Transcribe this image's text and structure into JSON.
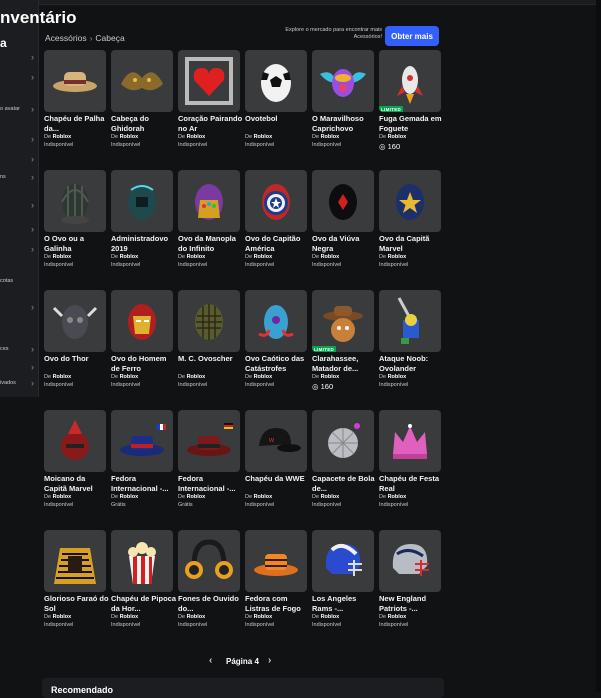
{
  "page": {
    "title": "nventário",
    "breadcrumb": [
      "Acessórios",
      "Cabeça"
    ],
    "explore_text": "Explore o mercado para encontrar mais Acessórios!",
    "get_more_label": "Obter mais",
    "page_label": "Página 4",
    "recommended_label": "Recomendado"
  },
  "sidebar": {
    "title": "a",
    "items": [
      {
        "label": "",
        "chevron": "›"
      },
      {
        "label": "",
        "chevron": "›"
      },
      {
        "label": "o avatar",
        "chevron": "›"
      },
      {
        "label": "",
        "chevron": "›"
      },
      {
        "label": "",
        "chevron": "›"
      },
      {
        "label": "ns",
        "chevron": "›"
      },
      {
        "label": "",
        "chevron": "›"
      },
      {
        "label": "",
        "chevron": "›"
      },
      {
        "label": "",
        "chevron": "›"
      },
      {
        "label": "cotas",
        "chevron": ""
      },
      {
        "label": "",
        "chevron": "›"
      },
      {
        "label": "",
        "chevron": ""
      },
      {
        "label": "ces",
        "chevron": "›"
      },
      {
        "label": "",
        "chevron": "›"
      },
      {
        "label": "ivados",
        "chevron": "›"
      }
    ]
  },
  "items": [
    {
      "name": "Chapéu de Palha da...",
      "creator_prefix": "De",
      "creator": "Roblox",
      "status": "Indisponível",
      "icon": "straw-hat-icon"
    },
    {
      "name": "Cabeça do Ghidorah",
      "creator_prefix": "De",
      "creator": "Roblox",
      "status": "Indisponível",
      "icon": "ghidorah-head-icon"
    },
    {
      "name": "Coração Pairando no Ar",
      "creator_prefix": "De",
      "creator": "Roblox",
      "status": "Indisponível",
      "icon": "floating-heart-icon"
    },
    {
      "name": "Ovotebol",
      "creator_prefix": "De",
      "creator": "Roblox",
      "status": "Indisponível",
      "icon": "soccer-egg-icon"
    },
    {
      "name": "O Maravilhoso Caprichovo",
      "creator_prefix": "De",
      "creator": "Roblox",
      "status": "Indisponível",
      "icon": "winged-egg-icon"
    },
    {
      "name": "Fuga Gemada em Foguete",
      "creator_prefix": "De",
      "creator": "Roblox",
      "status": "",
      "price": "160",
      "badge": "LIMITED",
      "icon": "rocket-egg-icon"
    },
    {
      "name": "O Ovo ou a Galinha",
      "creator_prefix": "De",
      "creator": "Roblox",
      "status": "Indisponível",
      "icon": "caged-egg-icon"
    },
    {
      "name": "Administradovo 2019",
      "creator_prefix": "De",
      "creator": "Roblox",
      "status": "Indisponível",
      "icon": "admin-egg-icon"
    },
    {
      "name": "Ovo da Manopla do Infinito",
      "creator_prefix": "De",
      "creator": "Roblox",
      "status": "Indisponível",
      "icon": "gauntlet-egg-icon"
    },
    {
      "name": "Ovo do Capitão América",
      "creator_prefix": "De",
      "creator": "Roblox",
      "status": "Indisponível",
      "icon": "captain-america-egg-icon"
    },
    {
      "name": "Ovo da Viúva Negra",
      "creator_prefix": "De",
      "creator": "Roblox",
      "status": "Indisponível",
      "icon": "black-widow-egg-icon"
    },
    {
      "name": "Ovo da Capitã Marvel",
      "creator_prefix": "De",
      "creator": "Roblox",
      "status": "Indisponível",
      "icon": "captain-marvel-egg-icon"
    },
    {
      "name": "Ovo do Thor",
      "creator_prefix": "De",
      "creator": "Roblox",
      "status": "Indisponível",
      "icon": "thor-egg-icon"
    },
    {
      "name": "Ovo do Homem de Ferro",
      "creator_prefix": "De",
      "creator": "Roblox",
      "status": "Indisponível",
      "icon": "iron-man-egg-icon"
    },
    {
      "name": "M. C. Ovoscher",
      "creator_prefix": "De",
      "creator": "Roblox",
      "status": "Indisponível",
      "icon": "escher-egg-icon"
    },
    {
      "name": "Ovo Caótico das Catástrofes",
      "creator_prefix": "De",
      "creator": "Roblox",
      "status": "Indisponível",
      "icon": "chaos-egg-icon"
    },
    {
      "name": "Clarahassee, Matador de...",
      "creator_prefix": "De",
      "creator": "Roblox",
      "status": "",
      "price": "160",
      "badge": "LIMITED",
      "icon": "cowboy-egg-icon"
    },
    {
      "name": "Ataque Noob: Ovolander",
      "creator_prefix": "De",
      "creator": "Roblox",
      "status": "Indisponível",
      "icon": "noob-sword-icon"
    },
    {
      "name": "Moicano da Capitã Marvel",
      "creator_prefix": "De",
      "creator": "Roblox",
      "status": "Indisponível",
      "icon": "mohawk-helmet-icon"
    },
    {
      "name": "Fedora Internacional -...",
      "creator_prefix": "De",
      "creator": "Roblox",
      "status": "Grátis",
      "icon": "fedora-france-icon"
    },
    {
      "name": "Fedora Internacional -...",
      "creator_prefix": "De",
      "creator": "Roblox",
      "status": "Grátis",
      "icon": "fedora-germany-icon"
    },
    {
      "name": "Chapéu da WWE",
      "creator_prefix": "De",
      "creator": "Roblox",
      "status": "Indisponível",
      "icon": "wwe-cap-icon"
    },
    {
      "name": "Capacete de Bola de...",
      "creator_prefix": "De",
      "creator": "Roblox",
      "status": "Indisponível",
      "icon": "disco-helmet-icon"
    },
    {
      "name": "Chapéu de Festa Real",
      "creator_prefix": "De",
      "creator": "Roblox",
      "status": "Indisponível",
      "icon": "pink-crown-icon"
    },
    {
      "name": "Glorioso Faraó do Sol",
      "creator_prefix": "De",
      "creator": "Roblox",
      "status": "Indisponível",
      "icon": "pharaoh-headdress-icon"
    },
    {
      "name": "Chapéu de Pipoca da Hor...",
      "creator_prefix": "De",
      "creator": "Roblox",
      "status": "Indisponível",
      "icon": "popcorn-hat-icon"
    },
    {
      "name": "Fones de Ouvido do...",
      "creator_prefix": "De",
      "creator": "Roblox",
      "status": "Indisponível",
      "icon": "headphones-icon"
    },
    {
      "name": "Fedora com Listras de Fogo",
      "creator_prefix": "De",
      "creator": "Roblox",
      "status": "Indisponível",
      "icon": "flame-fedora-icon"
    },
    {
      "name": "Los Angeles Rams -...",
      "creator_prefix": "De",
      "creator": "Roblox",
      "status": "Indisponível",
      "icon": "rams-helmet-icon"
    },
    {
      "name": "New England Patriots -...",
      "creator_prefix": "De",
      "creator": "Roblox",
      "status": "Indisponível",
      "icon": "patriots-helmet-icon"
    }
  ],
  "colors": {
    "background": "#111214",
    "card": "#393b3d",
    "accent": "#335fff",
    "limited": "#08a550"
  }
}
